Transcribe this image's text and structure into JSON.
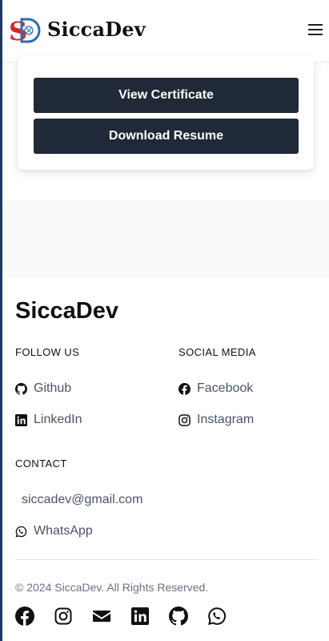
{
  "nav": {
    "brand": "SiccaDev",
    "logo_letters": "SD"
  },
  "card": {
    "view_certificate": "View Certificate",
    "download_resume": "Download Resume"
  },
  "footer": {
    "title": "SiccaDev",
    "follow_us": {
      "heading": "FOLLOW US",
      "github": "Github",
      "linkedin": "LinkedIn"
    },
    "social_media": {
      "heading": "SOCIAL MEDIA",
      "facebook": "Facebook",
      "instagram": "Instagram"
    },
    "contact": {
      "heading": "CONTACT",
      "email": "siccadev@gmail.com",
      "whatsapp": "WhatsApp"
    },
    "copyright": "© 2024 SiccaDev. All Rights Reserved.",
    "social_icons": [
      "facebook-icon",
      "instagram-icon",
      "mail-icon",
      "linkedin-icon",
      "github-icon",
      "whatsapp-icon"
    ]
  },
  "colors": {
    "button_bg": "#1f2937",
    "logo_red": "#d62828",
    "logo_blue": "#2b6cb0",
    "link_gray": "#4b5563"
  }
}
